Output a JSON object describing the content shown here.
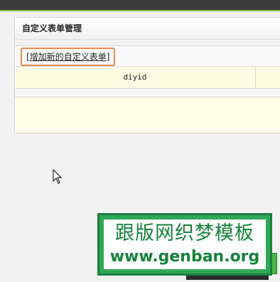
{
  "page": {
    "title": "自定义表单管理"
  },
  "toolbar": {
    "add_bracket_open": "[",
    "add_label": "增加新的自定义表单",
    "add_bracket_close": "]"
  },
  "table": {
    "columns": [
      "diyid"
    ]
  },
  "watermark": {
    "chinese": "跟版网织梦模板",
    "url": "www.genban.org"
  },
  "colors": {
    "accent_green": "#8fc23f",
    "highlight_orange": "#e8894f",
    "header_bg": "#fdfde4",
    "watermark_green": "#14823a"
  }
}
